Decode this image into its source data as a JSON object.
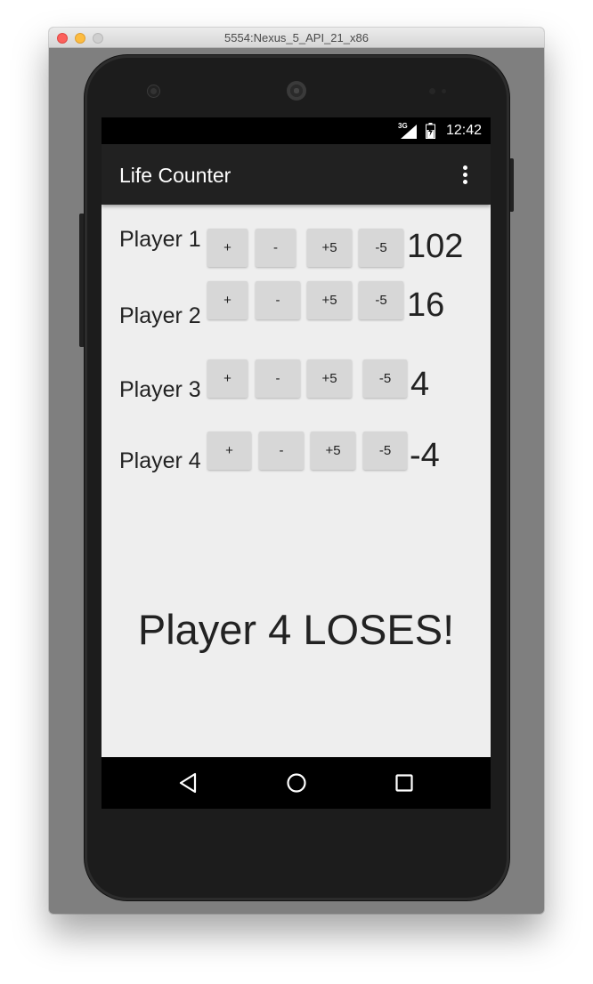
{
  "window": {
    "title": "5554:Nexus_5_API_21_x86"
  },
  "status_bar": {
    "network": "3G",
    "time": "12:42"
  },
  "action_bar": {
    "title": "Life Counter",
    "menu_icon": "overflow-menu-icon"
  },
  "players": [
    {
      "label": "Player 1",
      "buttons": [
        "+",
        "-",
        "+5",
        "-5"
      ],
      "life": "102"
    },
    {
      "label": "Player 2",
      "buttons": [
        "+",
        "-",
        "+5",
        "-5"
      ],
      "life": "16"
    },
    {
      "label": "Player 3",
      "buttons": [
        "+",
        "-",
        "+5",
        "-5"
      ],
      "life": "4"
    },
    {
      "label": "Player 4",
      "buttons": [
        "+",
        "-",
        "+5",
        "-5"
      ],
      "life": "-4"
    }
  ],
  "result_message": "Player 4 LOSES!",
  "nav_bar": {
    "icons": [
      "back-icon",
      "home-icon",
      "recent-apps-icon"
    ]
  },
  "colors": {
    "screen_background": "#eeeeee",
    "action_bar": "#212121",
    "button": "#d7d7d7",
    "text": "#222222"
  }
}
